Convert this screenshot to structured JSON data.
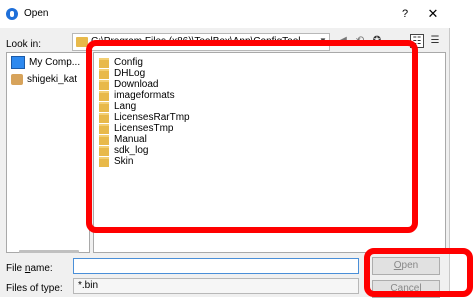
{
  "window": {
    "title": "Open",
    "help_label": "?",
    "close_label": "✕"
  },
  "lookin": {
    "label": "Look in:",
    "path": "C:\\Program Files (x86)\\ToolBox\\App\\ConfigTool",
    "toolbar": [
      "back-icon",
      "up-folder-icon",
      "new-folder-icon",
      "list-view-icon",
      "details-view-icon"
    ]
  },
  "sidebar": {
    "items": [
      {
        "label": "My Comp...",
        "icon": "computer-icon"
      },
      {
        "label": "shigeki_kat",
        "icon": "user-folder-icon"
      }
    ]
  },
  "files": [
    "Config",
    "DHLog",
    "Download",
    "imageformats",
    "Lang",
    "LicensesRarTmp",
    "LicensesTmp",
    "Manual",
    "sdk_log",
    "Skin"
  ],
  "filename": {
    "label_pre": "File ",
    "label_u": "n",
    "label_post": "ame:",
    "value": ""
  },
  "filetype": {
    "label": "Files of type:",
    "value": "*.bin"
  },
  "buttons": {
    "open_u": "O",
    "open_rest": "pen",
    "cancel": "Cancel"
  },
  "colors": {
    "annotation": "#ff0000",
    "folder": "#e8b94a",
    "input_focus": "#4a8fd8"
  }
}
